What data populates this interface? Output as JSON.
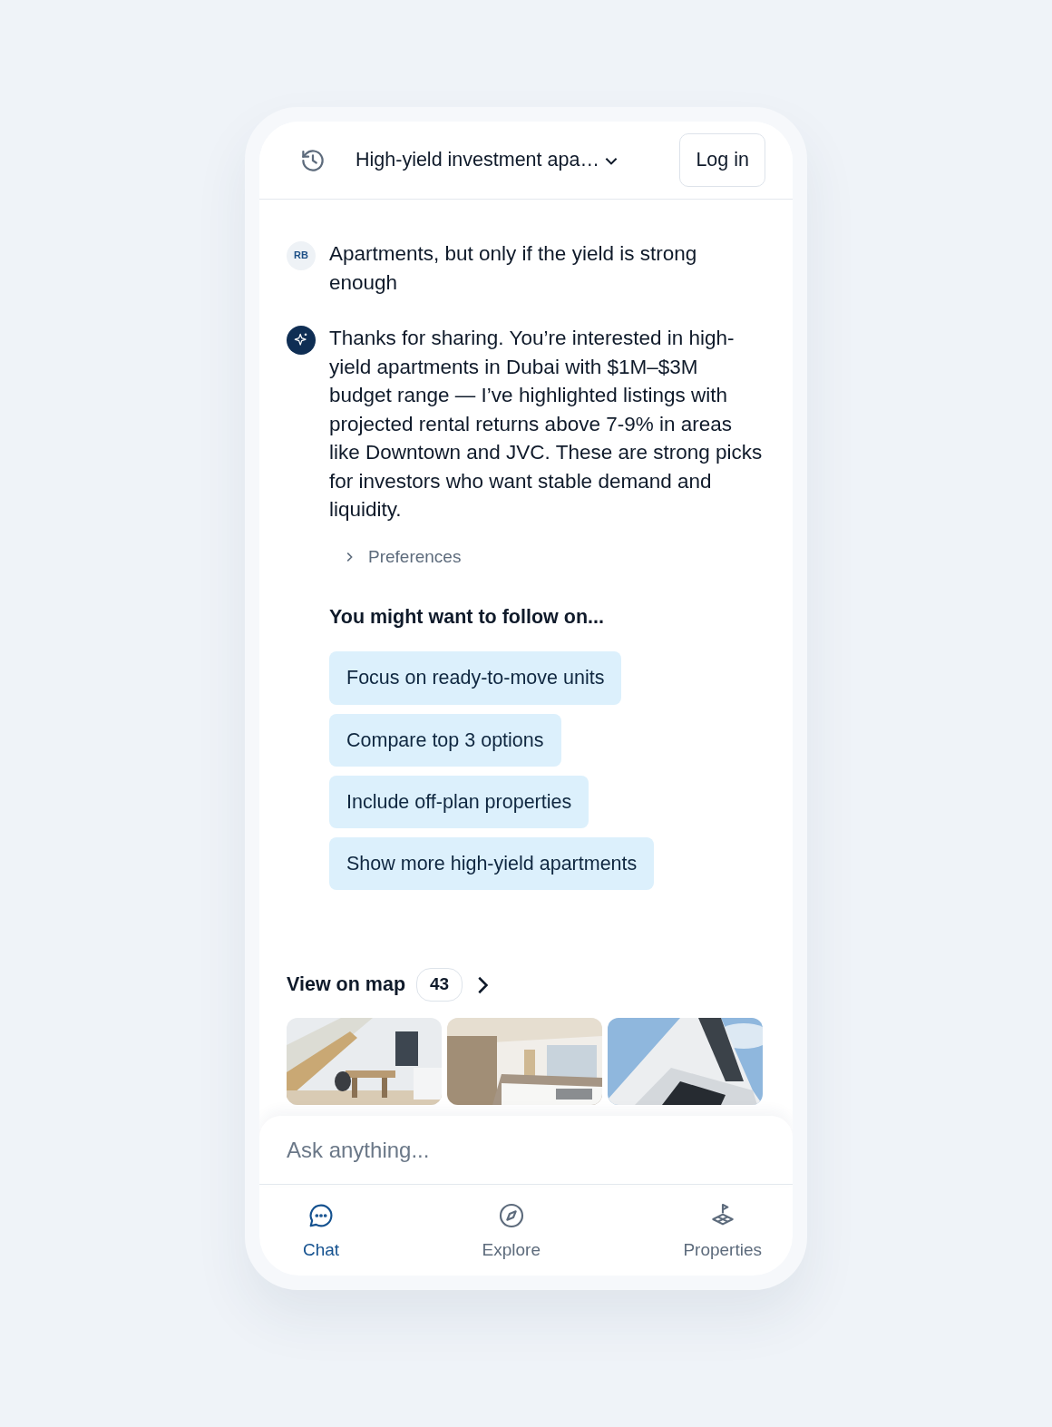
{
  "header": {
    "title": "High-yield investment apa…",
    "login": "Log in"
  },
  "messages": [
    {
      "kind": "user",
      "avatar": "RB",
      "text": "Apartments, but only if the yield is strong enough"
    },
    {
      "kind": "assistant",
      "text": "Thanks for sharing. You’re interested in high-yield apartments in Dubai with $1M–$3M budget range — I’ve highlighted listings with projected rental returns above 7-9% in areas like Downtown and JVC. These are strong picks for investors who want stable demand and liquidity."
    }
  ],
  "preferences": {
    "label": "Preferences",
    "expanded": false
  },
  "followups": {
    "title": "You might want to follow on...",
    "items": [
      "Focus on ready-to-move units",
      "Compare top 3 options",
      "Include off-plan properties",
      "Show more high-yield apartments"
    ]
  },
  "map": {
    "label": "View on map",
    "count": "43"
  },
  "input": {
    "placeholder": "Ask anything..."
  },
  "nav": [
    {
      "kind": "chat",
      "label": "Chat",
      "selected": true
    },
    {
      "kind": "explore",
      "label": "Explore",
      "selected": false
    },
    {
      "kind": "properties",
      "label": "Properties",
      "selected": false
    }
  ]
}
